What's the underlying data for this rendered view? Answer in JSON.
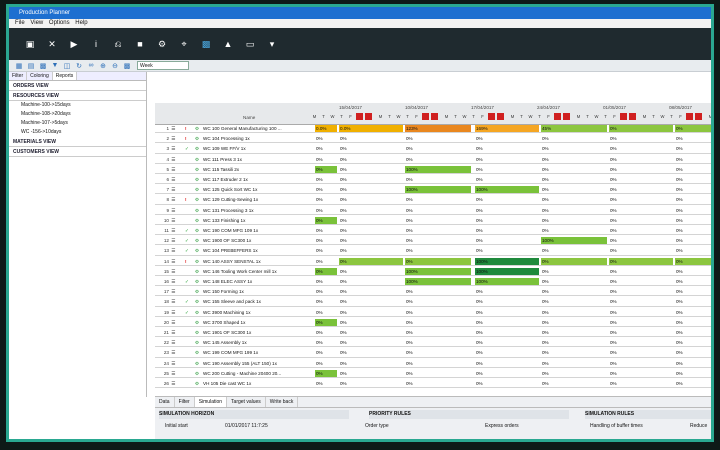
{
  "window": {
    "title": "Production Planner"
  },
  "menu": [
    "File",
    "View",
    "Options",
    "Help"
  ],
  "toolbar2": {
    "zoom_value": "Week"
  },
  "left_panel": {
    "tabs": [
      "Filter",
      "Coloring",
      "Reports"
    ],
    "sections": [
      "ORDERS VIEW",
      "RESOURCES VIEW",
      "MATERIALS VIEW",
      "CUSTOMERS VIEW"
    ],
    "resources": [
      "Machine-100->15days",
      "Machine-108->20days",
      "Machine-107->5days",
      "WC -156->10days"
    ]
  },
  "grid": {
    "header_name": "Name",
    "weeks": [
      "15/04/2017",
      "10/04/2017",
      "17/04/2017",
      "24/04/2017",
      "01/05/2017",
      "08/05/2017",
      "15/05/2017",
      "22/05"
    ],
    "rows": [
      {
        "n": "1",
        "name": "WC 100 General Manufacturing 100 ...",
        "v": [
          "0.0%",
          "123%",
          "169%",
          "45%",
          "0%",
          "0%"
        ],
        "mark": "alert"
      },
      {
        "n": "2",
        "name": "WC 104 Processing 1x",
        "v": [
          "0%",
          "0%",
          "0%",
          "0%",
          "0%",
          "0%"
        ],
        "mark": "alert"
      },
      {
        "n": "3",
        "name": "WC 109 WE FF/V 1x",
        "v": [
          "0%",
          "0%",
          "0%",
          "0%",
          "0%",
          "0%"
        ],
        "mark": "check"
      },
      {
        "n": "4",
        "name": "WC 111 Press 3 1x",
        "v": [
          "0%",
          "0%",
          "0%",
          "0%",
          "0%",
          "0%"
        ],
        "mark": ""
      },
      {
        "n": "5",
        "name": "WC 115 Tassili 2x",
        "v": [
          "0%",
          "100%",
          "0%",
          "0%",
          "0%",
          "0%"
        ],
        "mark": ""
      },
      {
        "n": "6",
        "name": "WC 117 Extruder 2 1x",
        "v": [
          "0%",
          "0%",
          "0%",
          "0%",
          "0%",
          "0%"
        ],
        "mark": ""
      },
      {
        "n": "7",
        "name": "WC 125 Quick Sort WC 1x",
        "v": [
          "0%",
          "100%",
          "100%",
          "0%",
          "0%",
          "0%"
        ],
        "mark": ""
      },
      {
        "n": "8",
        "name": "WC 129 Cutting-Sewing 1x",
        "v": [
          "0%",
          "0%",
          "0%",
          "0%",
          "0%",
          "0%"
        ],
        "mark": "alert"
      },
      {
        "n": "9",
        "name": "WC 131 Processing 3 1x",
        "v": [
          "0%",
          "0%",
          "0%",
          "0%",
          "0%",
          "0%"
        ],
        "mark": ""
      },
      {
        "n": "10",
        "name": "WC 133 Finishing 1x",
        "v": [
          "0%",
          "0%",
          "0%",
          "0%",
          "0%",
          "0%"
        ],
        "mark": ""
      },
      {
        "n": "11",
        "name": "WC 190 COM MFG 109 1x",
        "v": [
          "0%",
          "0%",
          "0%",
          "0%",
          "0%",
          "0%"
        ],
        "mark": "check"
      },
      {
        "n": "12",
        "name": "WC 1900 OF SC300 1x",
        "v": [
          "0%",
          "0%",
          "0%",
          "100%",
          "0%",
          "0%"
        ],
        "mark": "check"
      },
      {
        "n": "13",
        "name": "WC 104 PREBEFFERS 1x",
        "v": [
          "0%",
          "0%",
          "0%",
          "0%",
          "0%",
          "0%"
        ],
        "mark": "check"
      },
      {
        "n": "14",
        "name": "WC 140 ASSY SENSTAL 1x",
        "v": [
          "0%",
          "0%",
          "100%",
          "0%",
          "0%",
          "0%"
        ],
        "mark": "alert"
      },
      {
        "n": "15",
        "name": "WC 146 Tooling Work Center mill 1x",
        "v": [
          "0%",
          "100%",
          "100%",
          "0%",
          "0%",
          "0%"
        ],
        "mark": ""
      },
      {
        "n": "16",
        "name": "WC 148 ELEC ASSY 1x",
        "v": [
          "0%",
          "100%",
          "100%",
          "0%",
          "0%",
          "0%"
        ],
        "mark": "check"
      },
      {
        "n": "17",
        "name": "WC 150 Forming 1x",
        "v": [
          "0%",
          "0%",
          "0%",
          "0%",
          "0%",
          "0%"
        ],
        "mark": ""
      },
      {
        "n": "18",
        "name": "WC 155 Sleeve and pack 1x",
        "v": [
          "0%",
          "0%",
          "0%",
          "0%",
          "0%",
          "0%"
        ],
        "mark": "check"
      },
      {
        "n": "19",
        "name": "WC 3900 Machining 1x",
        "v": [
          "0%",
          "0%",
          "0%",
          "0%",
          "0%",
          "0%"
        ],
        "mark": "check"
      },
      {
        "n": "20",
        "name": "WC 3700 Shaped 1x",
        "v": [
          "0%",
          "0%",
          "0%",
          "0%",
          "0%",
          "0%"
        ],
        "mark": ""
      },
      {
        "n": "21",
        "name": "WC 1901 OF SC300 1x",
        "v": [
          "0%",
          "0%",
          "0%",
          "0%",
          "0%",
          "0%"
        ],
        "mark": ""
      },
      {
        "n": "22",
        "name": "WC 145 Assembly 1x",
        "v": [
          "0%",
          "0%",
          "0%",
          "0%",
          "0%",
          "0%"
        ],
        "mark": ""
      },
      {
        "n": "23",
        "name": "WC 199 COM MFG 199 1x",
        "v": [
          "0%",
          "0%",
          "0%",
          "0%",
          "0%",
          "0%"
        ],
        "mark": ""
      },
      {
        "n": "24",
        "name": "WC 190 Assembly 155 (ALT 150) 1x",
        "v": [
          "0%",
          "0%",
          "0%",
          "0%",
          "0%",
          "0%"
        ],
        "mark": ""
      },
      {
        "n": "25",
        "name": "WC 200 Cutting - Machine 20400 20...",
        "v": [
          "0%",
          "0%",
          "0%",
          "0%",
          "0%",
          "0%"
        ],
        "mark": ""
      },
      {
        "n": "26",
        "name": "VH 105 Die cast WC 1x",
        "v": [
          "0%",
          "0%",
          "0%",
          "0%",
          "0%",
          "0%"
        ],
        "mark": ""
      }
    ]
  },
  "bottom": {
    "tabs": [
      "Data",
      "Filter",
      "Simulation",
      "Target values",
      "Write back"
    ],
    "sections": [
      "SIMULATION HORIZON",
      "PRIORITY RULES",
      "SIMULATION RULES"
    ],
    "horizon_label": "Initial start",
    "horizon_value": "01/01/2017 11:7:25",
    "priority_label": "Order type",
    "priority_value": "Express orders",
    "sim_label": "Handling of buffer times",
    "sim_value": "Reduce"
  },
  "colors": {
    "accent": "#2aa891",
    "green": "#7ac23a",
    "dark_green": "#1f8a2c",
    "orange": "#e88d20",
    "red": "#d02020",
    "toolbar": "#1f2a2f"
  }
}
